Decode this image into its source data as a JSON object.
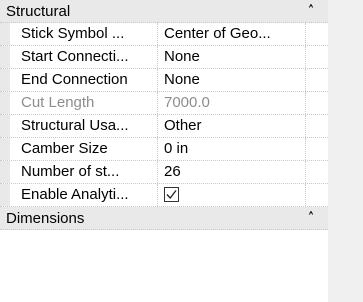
{
  "groups": [
    {
      "label": "Structural",
      "collapse_icon": "collapse-chevrons-up-icon",
      "rows": [
        {
          "name": "Stick Symbol ...",
          "value": "Center of Geo..."
        },
        {
          "name": "Start Connecti...",
          "value": "None"
        },
        {
          "name": "End Connection",
          "value": "None"
        },
        {
          "name": "Cut Length",
          "value": "7000.0",
          "state": "disabled"
        },
        {
          "name": "Structural Usa...",
          "value": "Other"
        },
        {
          "name": "Camber Size",
          "value": "0 in"
        },
        {
          "name": "Number of st...",
          "value": "26"
        },
        {
          "name": "Enable Analyti...",
          "checked": true,
          "check_icon": "checkmark-icon"
        }
      ]
    },
    {
      "label": "Dimensions",
      "collapse_icon": "collapse-chevrons-up-icon"
    }
  ],
  "colors": {
    "group_header_bg": "#e9e9e9",
    "gridline": "#c8c8c8",
    "disabled_text": "#8d8d8d",
    "gutter_bg": "#f0f0f0"
  }
}
